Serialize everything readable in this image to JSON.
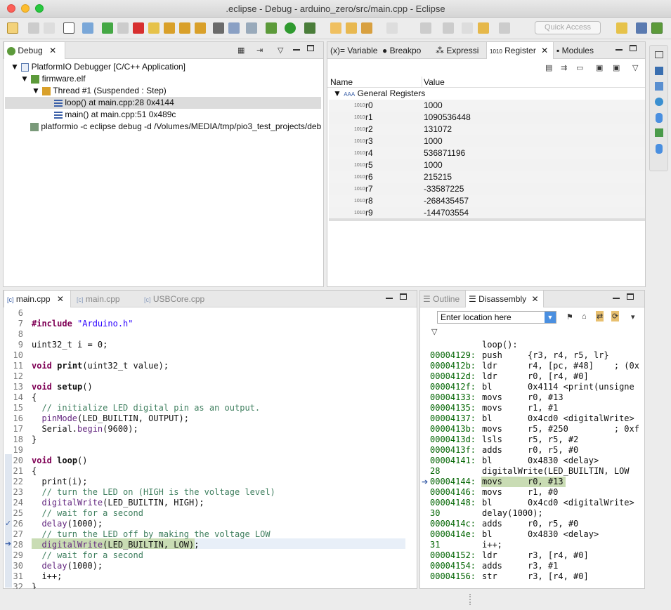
{
  "window": {
    "title": ".eclipse - Debug - arduino_zero/src/main.cpp - Eclipse"
  },
  "toolbar": {
    "quick_access": "Quick Access"
  },
  "debug_view": {
    "tab_label": "Debug",
    "items": [
      {
        "label": "PlatformIO Debugger [C/C++ Application]"
      },
      {
        "label": "firmware.elf"
      },
      {
        "label": "Thread #1 (Suspended : Step)"
      },
      {
        "label": "loop() at main.cpp:28 0x4144"
      },
      {
        "label": "main() at main.cpp:51 0x489c"
      },
      {
        "label": "platformio -c eclipse debug -d /Volumes/MEDIA/tmp/pio3_test_projects/deb"
      }
    ]
  },
  "right_tabs": {
    "tabs": [
      "Variable",
      "Breakpo",
      "Expressi",
      "Register",
      "Modules"
    ]
  },
  "registers": {
    "col_name": "Name",
    "col_value": "Value",
    "group": "General Registers",
    "rows": [
      {
        "name": "r0",
        "value": "1000"
      },
      {
        "name": "r1",
        "value": "1090536448"
      },
      {
        "name": "r2",
        "value": "131072"
      },
      {
        "name": "r3",
        "value": "1000"
      },
      {
        "name": "r4",
        "value": "536871196"
      },
      {
        "name": "r5",
        "value": "1000"
      },
      {
        "name": "r6",
        "value": "215215"
      },
      {
        "name": "r7",
        "value": "-33587225"
      },
      {
        "name": "r8",
        "value": "-268435457"
      },
      {
        "name": "r9",
        "value": "-144703554"
      }
    ]
  },
  "editor": {
    "tabs": [
      "main.cpp",
      "main.cpp",
      "USBCore.cpp"
    ],
    "lines": [
      {
        "n": "6",
        "html": ""
      },
      {
        "n": "7",
        "html": "<span class='kw'>#include</span> <span class='str'>\"Arduino.h\"</span>"
      },
      {
        "n": "8",
        "html": ""
      },
      {
        "n": "9",
        "html": "uint32_t i = 0;"
      },
      {
        "n": "10",
        "html": ""
      },
      {
        "n": "11",
        "html": "<span class='kw'>void</span> <b>print</b>(uint32_t value);"
      },
      {
        "n": "12",
        "html": ""
      },
      {
        "n": "13",
        "html": "<span class='kw'>void</span> <b>setup</b>()"
      },
      {
        "n": "14",
        "html": "{"
      },
      {
        "n": "15",
        "html": "  <span class='cmt'>// initialize LED digital pin as an output.</span>"
      },
      {
        "n": "16",
        "html": "  <span class='fn'>pinMode</span>(LED_BUILTIN, OUTPUT);"
      },
      {
        "n": "17",
        "html": "  Serial.<span class='fn'>begin</span>(9600);"
      },
      {
        "n": "18",
        "html": "}"
      },
      {
        "n": "19",
        "html": ""
      },
      {
        "n": "20",
        "html": "<span class='kw'>void</span> <b>loop</b>()"
      },
      {
        "n": "21",
        "html": "{"
      },
      {
        "n": "22",
        "html": "  print(i);"
      },
      {
        "n": "23",
        "html": "  <span class='cmt'>// turn the LED on (HIGH is the voltage level)</span>"
      },
      {
        "n": "24",
        "html": "  <span class='fn'>digitalWrite</span>(LED_BUILTIN, HIGH);"
      },
      {
        "n": "25",
        "html": "  <span class='cmt'>// wait for a second</span>"
      },
      {
        "n": "26",
        "html": "  <span class='fn'>delay</span>(1000);"
      },
      {
        "n": "27",
        "html": "  <span class='cmt'>// turn the LED off by making the voltage LOW</span>"
      },
      {
        "n": "28",
        "html": "  <span class='fn'>digitalWrite</span>(LED_BUILTIN, LOW);"
      },
      {
        "n": "29",
        "html": "  <span class='cmt'>// wait for a second</span>"
      },
      {
        "n": "30",
        "html": "  <span class='fn'>delay</span>(1000);"
      },
      {
        "n": "31",
        "html": "  i++;"
      },
      {
        "n": "32",
        "html": "}"
      }
    ]
  },
  "outline_tabs": {
    "tabs": [
      "Outline",
      "Disassembly"
    ]
  },
  "disassembly": {
    "location_placeholder": "Enter location here",
    "lines": [
      {
        "a": "",
        "t": "          loop():"
      },
      {
        "a": "00004129:",
        "t": "push     {r3, r4, r5, lr}"
      },
      {
        "a": "0000412b:",
        "t": "ldr      r4, [pc, #48]    ; (0x"
      },
      {
        "a": "0000412d:",
        "t": "ldr      r0, [r4, #0]"
      },
      {
        "a": "0000412f:",
        "t": "bl       0x4114 <print(unsigne"
      },
      {
        "a": "00004133:",
        "t": "movs     r0, #13"
      },
      {
        "a": "00004135:",
        "t": "movs     r1, #1"
      },
      {
        "a": "00004137:",
        "t": "bl       0x4cd0 <digitalWrite>"
      },
      {
        "a": "0000413b:",
        "t": "movs     r5, #250         ; 0xf"
      },
      {
        "a": "0000413d:",
        "t": "lsls     r5, r5, #2"
      },
      {
        "a": "0000413f:",
        "t": "adds     r0, r5, #0"
      },
      {
        "a": "00004141:",
        "t": "bl       0x4830 <delay>"
      },
      {
        "a": "28",
        "t": "digitalWrite(LED_BUILTIN, LOW"
      },
      {
        "a": "00004144:",
        "t": "movs     r0, #13"
      },
      {
        "a": "00004146:",
        "t": "movs     r1, #0"
      },
      {
        "a": "00004148:",
        "t": "bl       0x4cd0 <digitalWrite>"
      },
      {
        "a": "30",
        "t": "delay(1000);"
      },
      {
        "a": "0000414c:",
        "t": "adds     r0, r5, #0"
      },
      {
        "a": "0000414e:",
        "t": "bl       0x4830 <delay>"
      },
      {
        "a": "31",
        "t": "i++;"
      },
      {
        "a": "00004152:",
        "t": "ldr      r3, [r4, #0]"
      },
      {
        "a": "00004154:",
        "t": "adds     r3, #1"
      },
      {
        "a": "00004156:",
        "t": "str      r3, [r4, #0]"
      }
    ]
  }
}
